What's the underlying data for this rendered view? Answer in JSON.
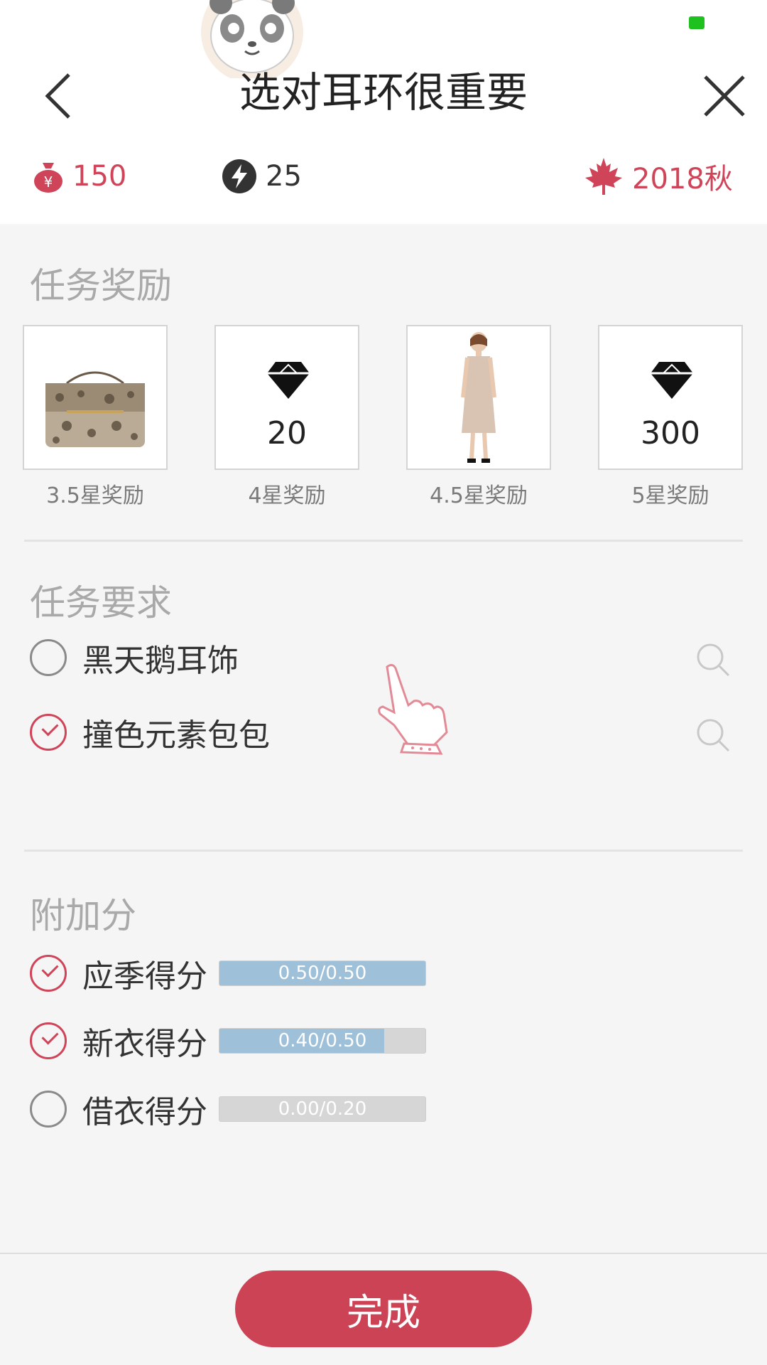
{
  "header": {
    "title": "选对耳环很重要",
    "back_icon": "chevron-left-icon",
    "close_icon": "close-icon"
  },
  "stats": {
    "money": "150",
    "energy": "25",
    "season": "2018秋"
  },
  "rewards": {
    "title": "任务奖励",
    "items": [
      {
        "caption": "3.5星奖励",
        "kind": "handbag-image"
      },
      {
        "caption": "4星奖励",
        "kind": "diamond-icon",
        "value": "20"
      },
      {
        "caption": "4.5星奖励",
        "kind": "dress-model-image"
      },
      {
        "caption": "5星奖励",
        "kind": "diamond-icon",
        "value": "300"
      }
    ]
  },
  "requirements": {
    "title": "任务要求",
    "items": [
      {
        "label": "黑天鹅耳饰",
        "checked": false
      },
      {
        "label": "撞色元素包包",
        "checked": true
      }
    ]
  },
  "bonus": {
    "title": "附加分",
    "items": [
      {
        "label": "应季得分",
        "checked": true,
        "progress_text": "0.50/0.50",
        "progress": 1.0
      },
      {
        "label": "新衣得分",
        "checked": true,
        "progress_text": "0.40/0.50",
        "progress": 0.8
      },
      {
        "label": "借衣得分",
        "checked": false,
        "progress_text": "0.00/0.20",
        "progress": 0.0
      }
    ]
  },
  "footer": {
    "done_label": "完成"
  },
  "colors": {
    "accent": "#cc4356",
    "progress_fill": "#9ec0d8",
    "status_green": "#1ec11e"
  }
}
